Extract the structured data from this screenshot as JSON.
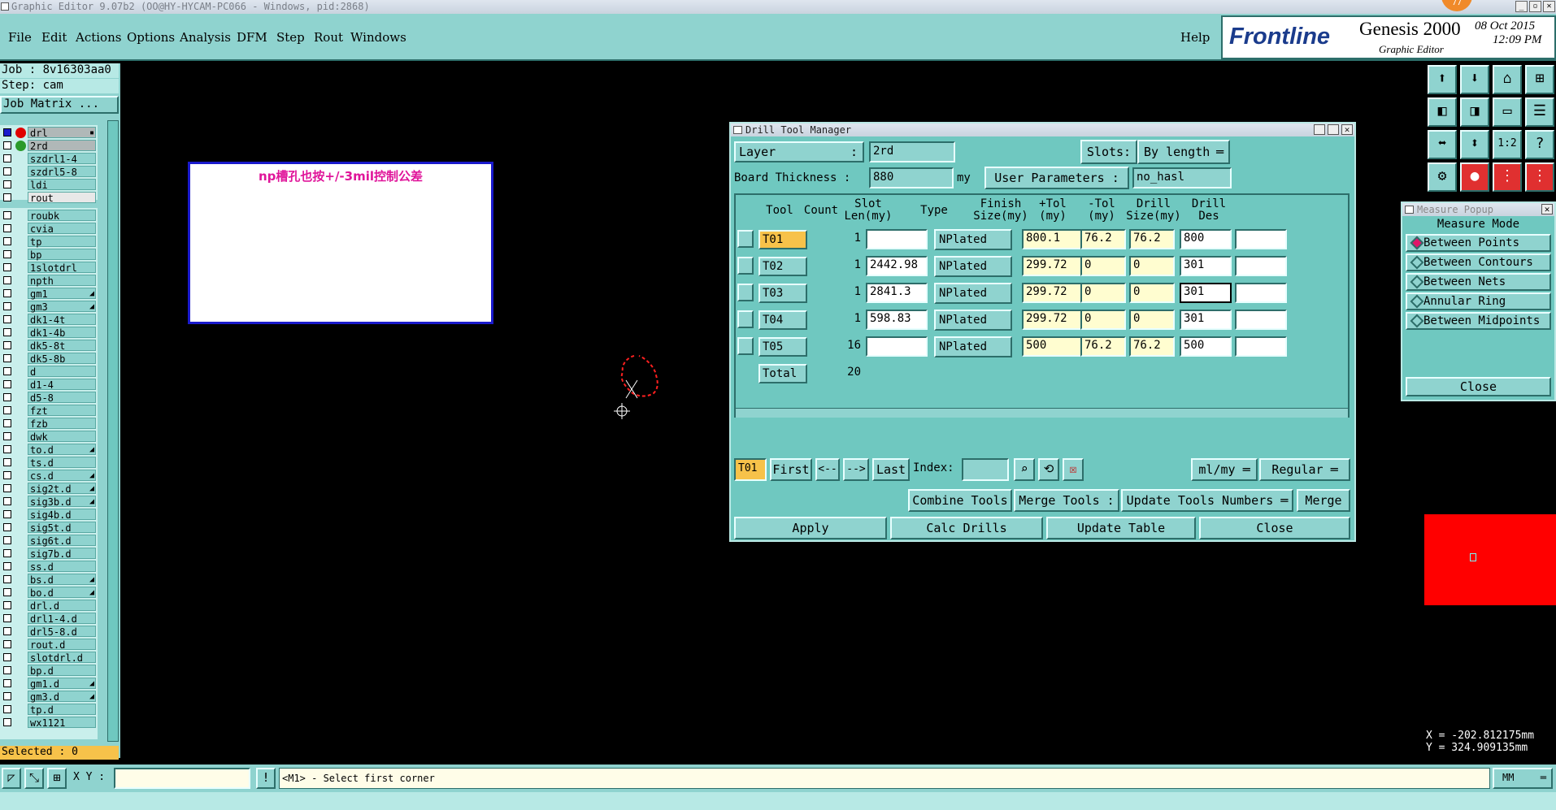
{
  "window_title": "Graphic Editor 9.07b2 (OO@HY-HYCAM-PC066 - Windows, pid:2868)",
  "menu": [
    "File",
    "Edit",
    "Actions",
    "Options",
    "Analysis",
    "DFM",
    "Step",
    "Rout",
    "Windows"
  ],
  "help": "Help",
  "brand": {
    "logo": "Frontline",
    "product": "Genesis 2000",
    "subtitle": "Graphic Editor",
    "date": "08 Oct 2015",
    "time": "12:09 PM",
    "badge": "77"
  },
  "left": {
    "job": "Job : 8v16303aa0",
    "step": "Step: cam",
    "job_matrix": "Job Matrix ...",
    "selected": "Selected : 0"
  },
  "layers_top": [
    {
      "name": "drl",
      "dot": "#e00000",
      "mark": "▪"
    },
    {
      "name": "2rd",
      "dot": "#2a9a2a",
      "mark": ""
    },
    {
      "name": "szdrl1-4",
      "dot": "",
      "mark": ""
    },
    {
      "name": "szdrl5-8",
      "dot": "",
      "mark": ""
    },
    {
      "name": "ldi",
      "dot": "",
      "mark": ""
    },
    {
      "name": "rout",
      "dot": "",
      "mark": ""
    }
  ],
  "layers": [
    {
      "name": "roubk",
      "mark": ""
    },
    {
      "name": "cvia",
      "mark": ""
    },
    {
      "name": "tp",
      "mark": ""
    },
    {
      "name": "bp",
      "mark": ""
    },
    {
      "name": "1slotdrl",
      "mark": ""
    },
    {
      "name": "npth",
      "mark": ""
    },
    {
      "name": "gm1",
      "mark": "◢"
    },
    {
      "name": "gm3",
      "mark": "◢"
    },
    {
      "name": "dk1-4t",
      "mark": ""
    },
    {
      "name": "dk1-4b",
      "mark": ""
    },
    {
      "name": "dk5-8t",
      "mark": ""
    },
    {
      "name": "dk5-8b",
      "mark": ""
    },
    {
      "name": "d",
      "mark": ""
    },
    {
      "name": "d1-4",
      "mark": ""
    },
    {
      "name": "d5-8",
      "mark": ""
    },
    {
      "name": "fzt",
      "mark": ""
    },
    {
      "name": "fzb",
      "mark": ""
    },
    {
      "name": "dwk",
      "mark": ""
    },
    {
      "name": "to.d",
      "mark": "◢"
    },
    {
      "name": "ts.d",
      "mark": ""
    },
    {
      "name": "cs.d",
      "mark": "◢"
    },
    {
      "name": "sig2t.d",
      "mark": "◢"
    },
    {
      "name": "sig3b.d",
      "mark": "◢"
    },
    {
      "name": "sig4b.d",
      "mark": ""
    },
    {
      "name": "sig5t.d",
      "mark": ""
    },
    {
      "name": "sig6t.d",
      "mark": ""
    },
    {
      "name": "sig7b.d",
      "mark": ""
    },
    {
      "name": "ss.d",
      "mark": ""
    },
    {
      "name": "bs.d",
      "mark": "◢"
    },
    {
      "name": "bo.d",
      "mark": "◢"
    },
    {
      "name": "drl.d",
      "mark": ""
    },
    {
      "name": "drl1-4.d",
      "mark": ""
    },
    {
      "name": "drl5-8.d",
      "mark": ""
    },
    {
      "name": "rout.d",
      "mark": ""
    },
    {
      "name": "slotdrl.d",
      "mark": ""
    },
    {
      "name": "bp.d",
      "mark": ""
    },
    {
      "name": "gm1.d",
      "mark": "◢"
    },
    {
      "name": "gm3.d",
      "mark": "◢"
    },
    {
      "name": "tp.d",
      "mark": ""
    },
    {
      "name": "wx1121",
      "mark": ""
    }
  ],
  "note": "np槽孔也按+/-3mil控制公差",
  "drill": {
    "title": "Drill Tool Manager",
    "layer_label": "Layer",
    "layer_value": "2rd",
    "slots_label": "Slots:",
    "slots_value": "By length",
    "thickness_label": "Board Thickness :",
    "thickness_value": "880",
    "thickness_unit": "my",
    "user_params_label": "User Parameters :",
    "user_params_value": "no_hasl",
    "headers": [
      [
        "Tool",
        ""
      ],
      [
        "Count",
        ""
      ],
      [
        "Slot",
        "Len(my)"
      ],
      [
        "Type",
        ""
      ],
      [
        "Finish",
        "Size(my)"
      ],
      [
        "+Tol",
        "(my)"
      ],
      [
        "-Tol",
        "(my)"
      ],
      [
        "Drill",
        "Size(my)"
      ],
      [
        "Drill",
        "Des"
      ]
    ],
    "rows": [
      {
        "tool": "T01",
        "count": "1",
        "slot": "",
        "type": "NPlated",
        "finish": "800.1",
        "ptol": "76.2",
        "ntol": "76.2",
        "drill": "800",
        "des": ""
      },
      {
        "tool": "T02",
        "count": "1",
        "slot": "2442.98",
        "type": "NPlated",
        "finish": "299.72",
        "ptol": "0",
        "ntol": "0",
        "drill": "301",
        "des": ""
      },
      {
        "tool": "T03",
        "count": "1",
        "slot": "2841.3",
        "type": "NPlated",
        "finish": "299.72",
        "ptol": "0",
        "ntol": "0",
        "drill": "301",
        "des": ""
      },
      {
        "tool": "T04",
        "count": "1",
        "slot": "598.83",
        "type": "NPlated",
        "finish": "299.72",
        "ptol": "0",
        "ntol": "0",
        "drill": "301",
        "des": ""
      },
      {
        "tool": "T05",
        "count": "16",
        "slot": "",
        "type": "NPlated",
        "finish": "500",
        "ptol": "76.2",
        "ntol": "76.2",
        "drill": "500",
        "des": ""
      }
    ],
    "total_label": "Total",
    "total_count": "20",
    "nav": {
      "current": "T01",
      "first": "First",
      "prev": "<--",
      "next": "-->",
      "last": "Last",
      "index_label": "Index:",
      "units": "ml/my",
      "mode": "Regular"
    },
    "combine": "Combine Tools",
    "merge_tools": "Merge Tools :",
    "update_numbers": "Update Tools Numbers",
    "merge": "Merge",
    "apply": "Apply",
    "calc": "Calc Drills",
    "update_table": "Update Table",
    "close": "Close"
  },
  "measure": {
    "title": "Measure Popup",
    "mode_label": "Measure Mode",
    "options": [
      "Between Points",
      "Between Contours",
      "Between Nets",
      "Annular Ring",
      "Between Midpoints"
    ],
    "selected": "Between Points",
    "close": "Close"
  },
  "coords": {
    "x": "X = -202.812175mm",
    "y": "Y = 324.909135mm"
  },
  "status": {
    "xy_label": "X Y :",
    "message": "<M1> - Select first corner",
    "units": "MM"
  },
  "colors": {
    "panel": "#8fd3cf",
    "dialog": "#6fc8c0",
    "highlight": "#f7c24a",
    "field_yellow": "#fffdd0",
    "red_region": "#ff0000"
  }
}
